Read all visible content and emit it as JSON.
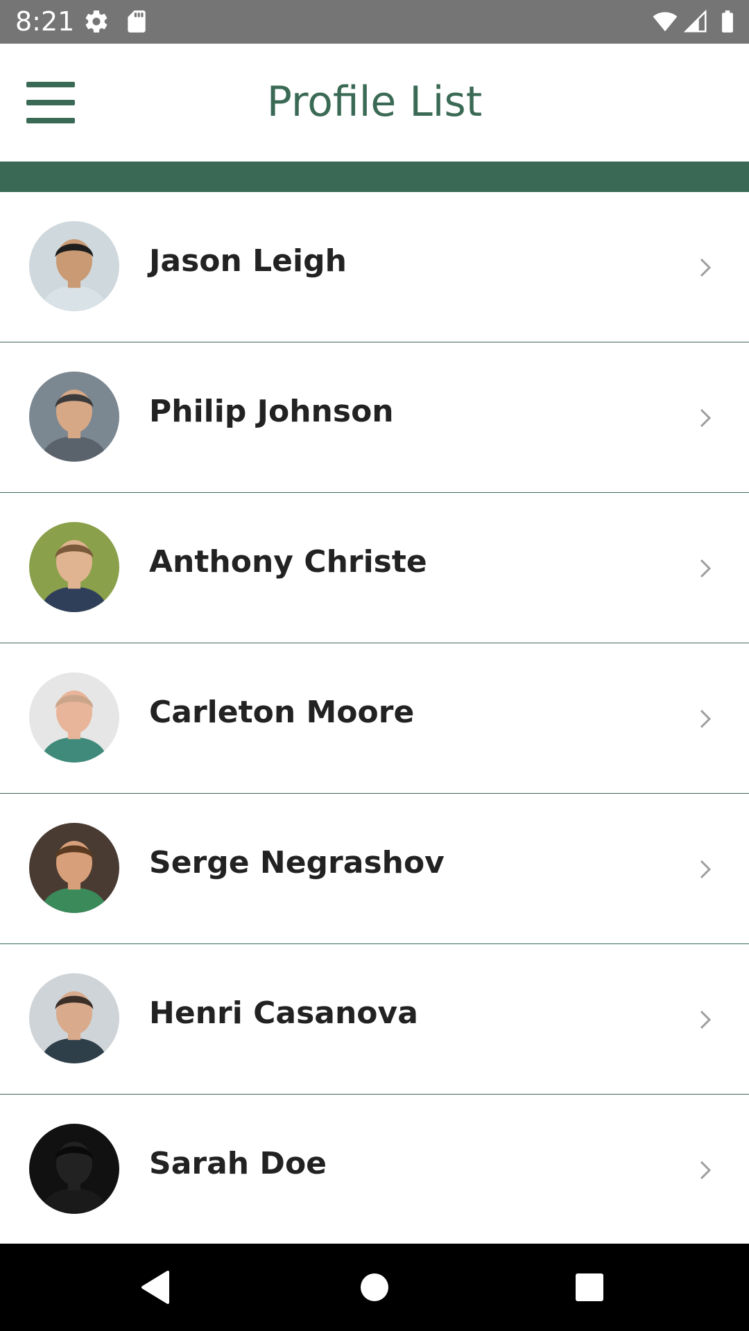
{
  "status_bar": {
    "time": "8:21",
    "left_icons": [
      "gear-icon",
      "sd-card-icon"
    ],
    "right_icons": [
      "wifi-icon",
      "cell-signal-icon",
      "battery-icon"
    ]
  },
  "app_bar": {
    "title": "Profile List",
    "menu_icon": "hamburger-menu-icon"
  },
  "colors": {
    "status_bar": "#757575",
    "brand_green": "#3a6a55",
    "text_dark": "#222222",
    "chevron": "#9e9e9e",
    "nav_bar": "#000000"
  },
  "profiles": [
    {
      "name": "Jason Leigh",
      "avatar_bg": "#cfd8dc",
      "skin": "#c99a73",
      "hair": "#1e1e1e",
      "shirt": "#d9e2e6"
    },
    {
      "name": "Philip Johnson",
      "avatar_bg": "#7b8791",
      "skin": "#d6a886",
      "hair": "#3b3b3b",
      "shirt": "#5a636b"
    },
    {
      "name": "Anthony Christe",
      "avatar_bg": "#8aa04a",
      "skin": "#e0b490",
      "hair": "#7a5a3a",
      "shirt": "#2f3f5a"
    },
    {
      "name": "Carleton Moore",
      "avatar_bg": "#e6e6e6",
      "skin": "#e8b59a",
      "hair": "#caa58a",
      "shirt": "#3f8a7a"
    },
    {
      "name": "Serge Negrashov",
      "avatar_bg": "#4a3b32",
      "skin": "#d8a07a",
      "hair": "#5a3a20",
      "shirt": "#3a8a5a"
    },
    {
      "name": "Henri Casanova",
      "avatar_bg": "#cfd4d8",
      "skin": "#d9ab8c",
      "hair": "#3b2f28",
      "shirt": "#2f3f4a"
    },
    {
      "name": "Sarah Doe",
      "avatar_bg": "#111111",
      "skin": "#222222",
      "hair": "#0a0a0a",
      "shirt": "#1a1a1a"
    }
  ],
  "nav_bar": {
    "buttons": [
      "back-triangle-icon",
      "home-circle-icon",
      "recents-square-icon"
    ]
  }
}
